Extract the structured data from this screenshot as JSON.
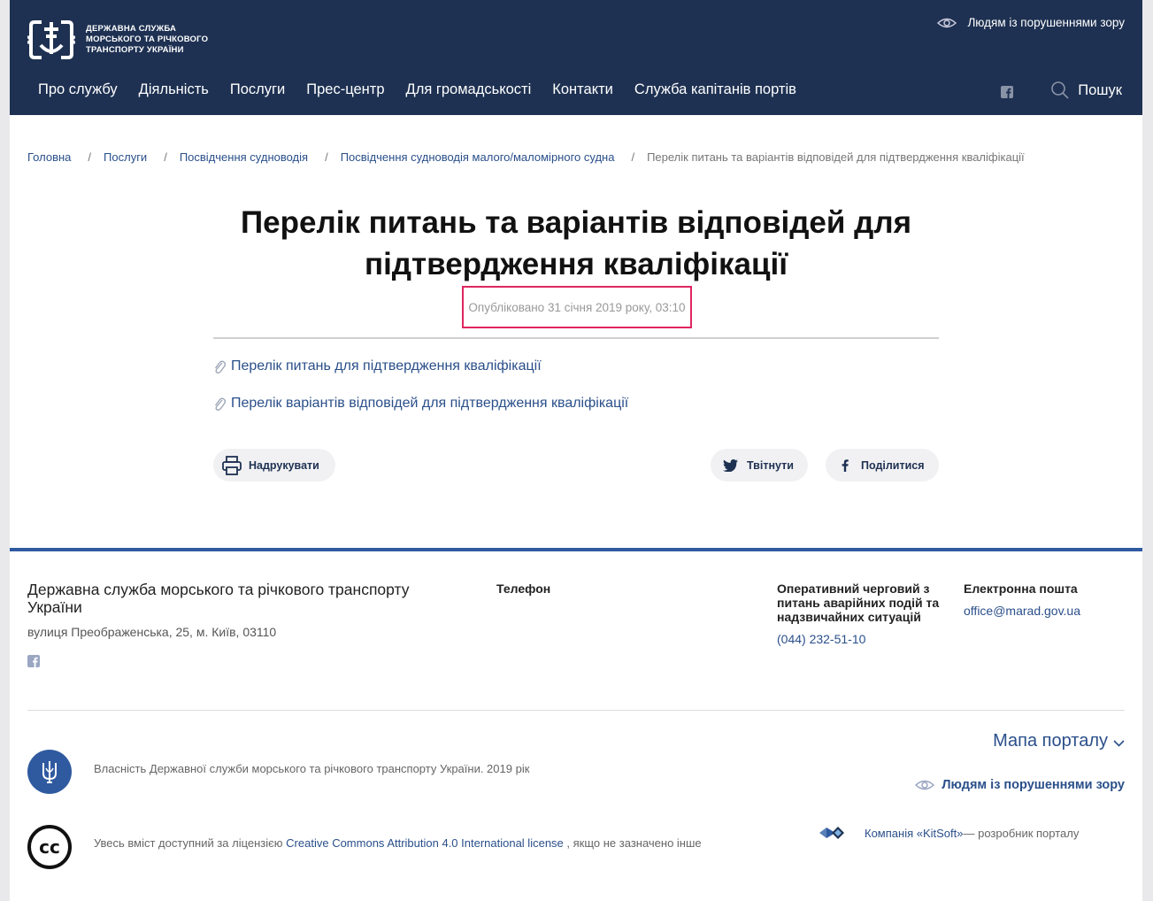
{
  "header": {
    "logo_lines": [
      "ДЕРЖАВНА СЛУЖБА",
      "МОРСЬКОГО ТА РІЧКОВОГО",
      "ТРАНСПОРТУ УКРАЇНИ"
    ],
    "vision_label": "Людям із порушеннями зору",
    "nav": [
      "Про службу",
      "Діяльність",
      "Послуги",
      "Прес-центр",
      "Для громадськості",
      "Контакти",
      "Служба капітанів портів"
    ],
    "search_label": "Пошук"
  },
  "breadcrumbs": {
    "items": [
      "Головна",
      "Послуги",
      "Посвідчення судноводія",
      "Посвідчення судноводія малого/маломірного судна"
    ],
    "separator": "/",
    "current": "Перелік питань та варіантів відповідей для підтвердження кваліфікації"
  },
  "article": {
    "title_line1": "Перелік питань та варіантів відповідей для",
    "title_line2": "підтвердження кваліфікації",
    "published": "Опубліковано 31 січня 2019 року, 03:10",
    "attachments": [
      "Перелік питань для підтвердження кваліфікації",
      "Перелік варіантів відповідей для підтвердження кваліфікації"
    ],
    "print_label": "Надрукувати",
    "tweet_label": "Твітнути",
    "share_label": "Поділитися"
  },
  "footer": {
    "org_name": "Державна служба морського та річкового транспорту України",
    "address": "вулиця Преображенська, 25, м. Київ, 03110",
    "phone_heading": "Телефон",
    "duty_heading": "Оперативний черговий з питань аварійних подій та надзвичайних ситуацій",
    "duty_phone": "(044) 232-51-10",
    "email_heading": "Електронна пошта",
    "email": "office@marad.gov.ua",
    "map_label": "Мапа порталу",
    "vision_label": "Людям із порушеннями зору",
    "ownership": "Власність Державної служби морського та річкового транспорту України. 2019 рік",
    "cc_badge": "cc",
    "license_prefix": "Увесь вміст доступний за ліцензією",
    "license_link": "Creative Commons Attribution 4.0 International license",
    "license_suffix": ", якщо не зазначено інше",
    "developer_link": "Компанія «KitSoft»",
    "developer_suffix": "— розробник порталу"
  },
  "colors": {
    "header_bg": "#1e3152",
    "link": "#2a4f8a",
    "accent_border": "#e02560",
    "footer_line": "#2f5aa0"
  }
}
